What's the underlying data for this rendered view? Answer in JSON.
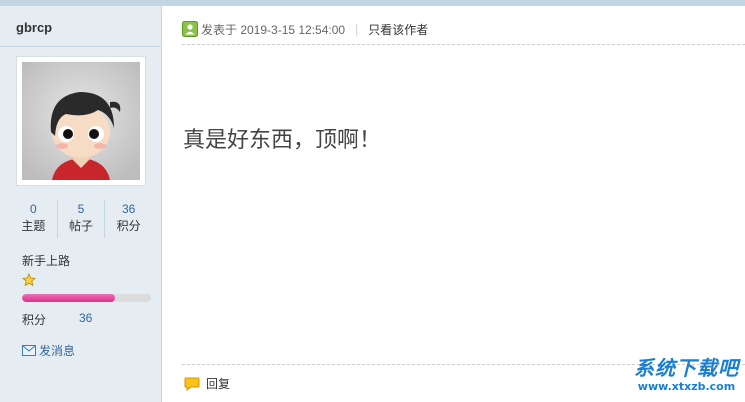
{
  "user": {
    "username": "gbrcp",
    "stats": [
      {
        "value": "0",
        "label": "主题"
      },
      {
        "value": "5",
        "label": "帖子"
      },
      {
        "value": "36",
        "label": "积分"
      }
    ],
    "group": "新手上路",
    "level_progress": 0.72,
    "credit_label": "积分",
    "credit_value": "36",
    "message_label": "发消息"
  },
  "post": {
    "posted_at": "发表于 2019-3-15 12:54:00",
    "author_only": "只看该作者",
    "content": "真是好东西，顶啊！",
    "reply_label": "回复"
  },
  "watermark": {
    "title": "系统下载吧",
    "url": "www.xtxzb.com"
  },
  "colors": {
    "sidebar_bg": "#e5edf2",
    "border": "#c2d5e3",
    "link": "#336699",
    "progress": "#e0489a"
  }
}
